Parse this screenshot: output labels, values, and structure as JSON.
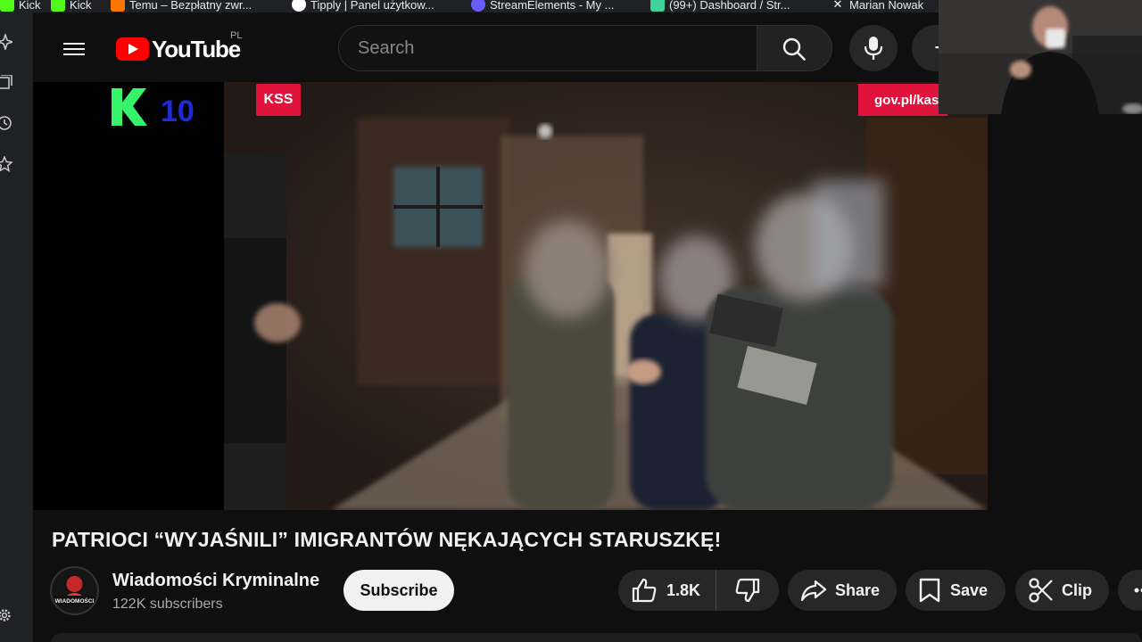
{
  "bookmarks": [
    {
      "label": "Kick",
      "color": "#53fc18"
    },
    {
      "label": "Kick",
      "color": "#53fc18"
    },
    {
      "label": "Temu – Bezpłatny zwr...",
      "color": "#fb7701"
    },
    {
      "label": "Tipply | Panel użytkow...",
      "color": "#ffffff"
    },
    {
      "label": "StreamElements - My ...",
      "color": "#6b5cff"
    },
    {
      "label": "(99+) Dashboard / Str...",
      "color": "#3fd39b"
    },
    {
      "label": "Marian Nowak",
      "color": "#ffffff"
    }
  ],
  "youtube": {
    "logo_text": "YouTube",
    "country_code": "PL",
    "search": {
      "placeholder": "Search",
      "value": ""
    }
  },
  "video": {
    "overlay": {
      "channel_number": "10",
      "kss_badge": "KSS",
      "gov_badge": "gov.pl/kas"
    },
    "title": "PATRIOCI “WYJAŚNILI” IMIGRANTÓW NĘKAJĄCYCH STARUSZKĘ!",
    "channel": {
      "name": "Wiadomości Kryminalne",
      "subscribers": "122K subscribers",
      "avatar_text": "WIADOMOŚCI"
    },
    "actions": {
      "subscribe": "Subscribe",
      "likes": "1.8K",
      "share": "Share",
      "save": "Save",
      "clip": "Clip"
    }
  },
  "colors": {
    "youtube_red": "#ff0000",
    "background": "#0f0f0f",
    "pill": "#272727",
    "kss_red": "#e0133c"
  }
}
